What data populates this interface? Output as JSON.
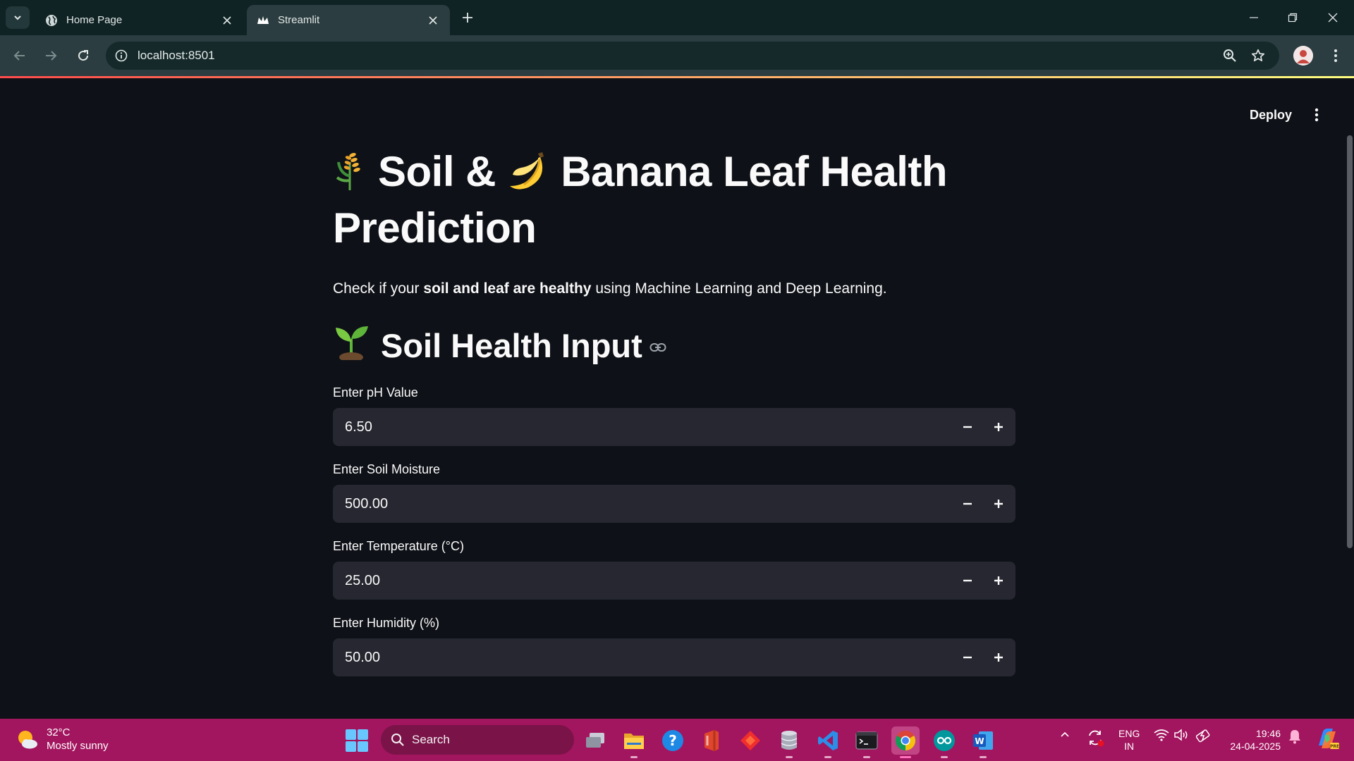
{
  "browser": {
    "tabs": [
      {
        "title": "Home Page",
        "active": false
      },
      {
        "title": "Streamlit",
        "active": true
      }
    ],
    "url": "localhost:8501"
  },
  "app": {
    "deploy_label": "Deploy",
    "title_part1": "Soil & ",
    "title_part2": "Banana Leaf Health",
    "title_part3": "Prediction",
    "title_emoji1": "🌾",
    "title_emoji2": "🍌",
    "subtitle_pre": "Check if your ",
    "subtitle_bold": "soil and leaf are healthy",
    "subtitle_post": " using Machine Learning and Deep Learning.",
    "section_emoji": "🌱",
    "section_title": "Soil Health Input",
    "fields": [
      {
        "label": "Enter pH Value",
        "value": "6.50"
      },
      {
        "label": "Enter Soil Moisture",
        "value": "500.00"
      },
      {
        "label": "Enter Temperature (°C)",
        "value": "25.00"
      },
      {
        "label": "Enter Humidity (%)",
        "value": "50.00"
      }
    ],
    "colors": {
      "background": "#0e1117",
      "input": "#262730",
      "accent": "#ff4b4b"
    }
  },
  "taskbar": {
    "weather_temp": "32°C",
    "weather_desc": "Mostly sunny",
    "search_placeholder": "Search",
    "lang_line1": "ENG",
    "lang_line2": "IN",
    "time": "19:46",
    "date": "24-04-2025",
    "color": "#a2155f"
  }
}
